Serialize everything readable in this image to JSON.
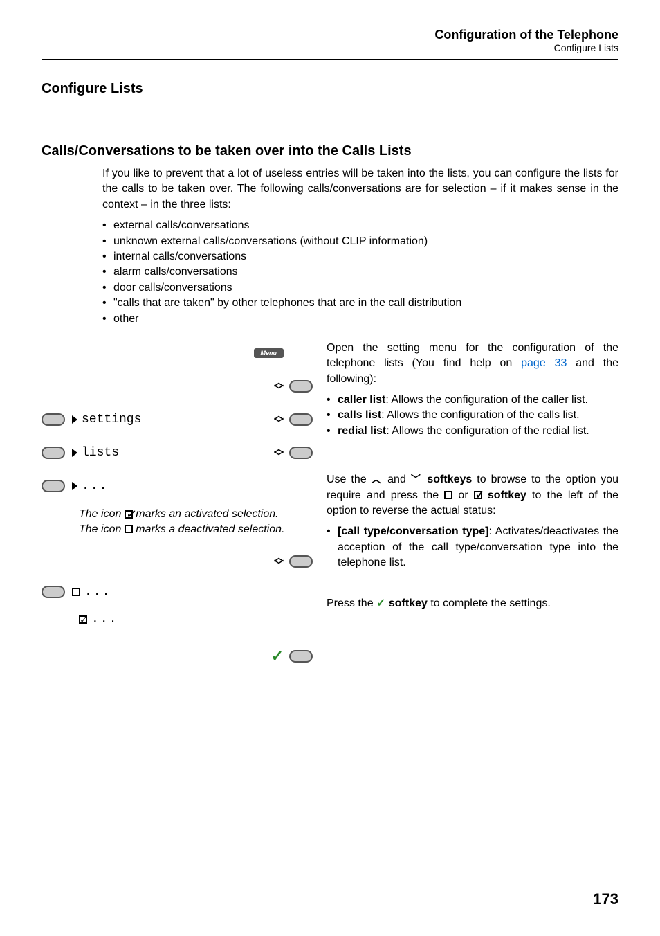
{
  "header": {
    "title": "Configuration of the Telephone",
    "subtitle": "Configure Lists"
  },
  "section_title": "Configure Lists",
  "subsection_title": "Calls/Conversations to be taken over into the Calls Lists",
  "intro_text": "If you like to prevent that a lot of useless entries will be taken into the lists, you can configure the lists for the calls to be taken over. The following calls/conversations are for selection – if it makes sense in the context – in the three lists:",
  "main_bullets": [
    "external calls/conversations",
    "unknown external calls/conversations (without CLIP information)",
    "internal calls/conversations",
    "alarm calls/conversations",
    "door calls/conversations",
    "\"calls that are taken\" by other telephones that are in the call distribution",
    "other"
  ],
  "menu_label": "Menu",
  "phone_items": {
    "settings": "settings",
    "lists": "lists",
    "ellipsis": "..."
  },
  "icon_note": {
    "part1": "The icon ",
    "part2": " marks an activated selection.",
    "part3": "The icon ",
    "part4": " marks a deactivated selection."
  },
  "right": {
    "open_intro_1": "Open the setting menu for the configuration of the telephone lists (You find help on ",
    "open_intro_link": "page 33",
    "open_intro_2": " and the following):",
    "list_items": [
      {
        "bold": "caller list",
        "rest": ": Allows the configuration of the caller list."
      },
      {
        "bold": "calls list",
        "rest": ": Allows the configuration of the calls list."
      },
      {
        "bold": "redial list",
        "rest": ": Allows the configuration of the redial list."
      }
    ],
    "browse_1": "Use the ",
    "browse_2": " and ",
    "browse_3": " softkeys",
    "browse_4": " to browse to the option you require and press the ",
    "browse_5": " or ",
    "browse_6": " softkey",
    "browse_7": " to the left of the option to reverse the actual status:",
    "call_type_bold": "[call type/conversation type]",
    "call_type_rest": ": Activates/deactivates the acception of the call type/conversation type into the telephone list.",
    "press_1": "Press the ",
    "press_2": " softkey",
    "press_3": " to complete the settings."
  },
  "page_number": "173"
}
